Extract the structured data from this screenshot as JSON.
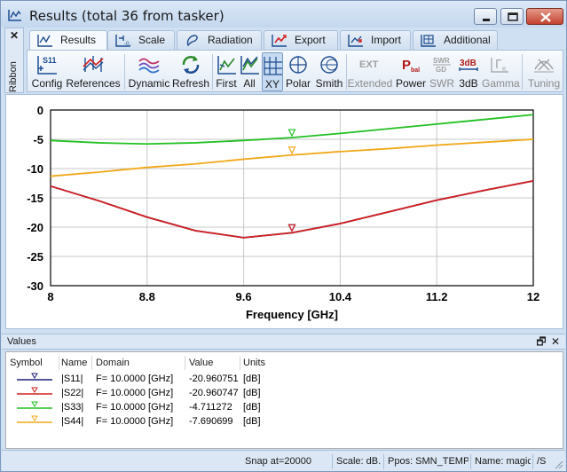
{
  "window": {
    "title": "Results (total 36 from tasker)"
  },
  "ribbon": {
    "close_glyph": "✕",
    "side_label": "Ribbon",
    "tabs": [
      {
        "label": "Results",
        "icon": "results-tab-icon"
      },
      {
        "label": "Scale",
        "icon": "scale-tab-icon"
      },
      {
        "label": "Radiation",
        "icon": "radiation-tab-icon"
      },
      {
        "label": "Export",
        "icon": "export-tab-icon"
      },
      {
        "label": "Import",
        "icon": "import-tab-icon"
      },
      {
        "label": "Additional",
        "icon": "additional-tab-icon"
      }
    ],
    "active_tab": "Results",
    "buttons": [
      {
        "label": "Config",
        "icon": "s11-config-icon",
        "enabled": true
      },
      {
        "label": "References",
        "icon": "references-icon",
        "enabled": true
      },
      {
        "label": "Dynamic",
        "icon": "dynamic-waves-icon",
        "enabled": true
      },
      {
        "label": "Refresh",
        "icon": "refresh-icon",
        "enabled": true
      },
      {
        "label": "First",
        "icon": "first-chart-icon",
        "enabled": true
      },
      {
        "label": "All",
        "icon": "all-chart-icon",
        "enabled": true
      },
      {
        "label": "XY",
        "icon": "xy-grid-icon",
        "enabled": true,
        "pressed": true
      },
      {
        "label": "Polar",
        "icon": "polar-icon",
        "enabled": true
      },
      {
        "label": "Smith",
        "icon": "smith-chart-icon",
        "enabled": true
      },
      {
        "label": "Extended",
        "icon_text": "EXT",
        "icon": "extended-icon",
        "enabled": false
      },
      {
        "label": "Power",
        "icon_text": "P",
        "icon_sub": "bal",
        "icon": "power-balance-icon",
        "enabled": true
      },
      {
        "label": "SWR",
        "icon_text": "SWR",
        "icon_sub": "GD",
        "icon": "swr-icon",
        "enabled": false
      },
      {
        "label": "3dB",
        "icon_text": "3dB",
        "icon": "3db-icon",
        "enabled": true
      },
      {
        "label": "Gamma",
        "icon_text": "Γ",
        "icon_sub": "K",
        "icon": "gamma-icon",
        "enabled": false
      },
      {
        "label": "Tuning",
        "icon": "tuning-icon",
        "enabled": false
      }
    ]
  },
  "chart_data": {
    "type": "line",
    "xlabel": "Frequency [GHz]",
    "ylabel": "",
    "xlim": [
      8,
      12
    ],
    "ylim": [
      -30,
      0
    ],
    "x_ticks": [
      "8",
      "8.8",
      "9.6",
      "10.4",
      "11.2",
      "12"
    ],
    "y_ticks": [
      "0",
      "-5",
      "-10",
      "-15",
      "-20",
      "-25",
      "-30"
    ],
    "grid": true,
    "series": [
      {
        "name": "|S11|",
        "color": "#1f1f7a",
        "x": [
          8,
          8.4,
          8.8,
          9.2,
          9.6,
          10.0,
          10.4,
          10.8,
          11.2,
          11.6,
          12
        ],
        "y": [
          -13.0,
          -15.5,
          -18.3,
          -20.6,
          -21.8,
          -20.96,
          -19.4,
          -17.4,
          -15.4,
          -13.7,
          -12.1
        ]
      },
      {
        "name": "|S22|",
        "color": "#d42020",
        "x": [
          8,
          8.4,
          8.8,
          9.2,
          9.6,
          10.0,
          10.4,
          10.8,
          11.2,
          11.6,
          12
        ],
        "y": [
          -13.0,
          -15.5,
          -18.3,
          -20.6,
          -21.8,
          -20.96,
          -19.4,
          -17.4,
          -15.4,
          -13.7,
          -12.1
        ]
      },
      {
        "name": "|S33|",
        "color": "#22c022",
        "x": [
          8,
          8.4,
          8.8,
          9.2,
          9.6,
          10.0,
          10.4,
          10.8,
          11.2,
          11.6,
          12
        ],
        "y": [
          -5.2,
          -5.6,
          -5.8,
          -5.6,
          -5.2,
          -4.71,
          -4.0,
          -3.2,
          -2.4,
          -1.6,
          -0.8
        ]
      },
      {
        "name": "|S44|",
        "color": "#f0a818",
        "x": [
          8,
          8.4,
          8.8,
          9.2,
          9.6,
          10.0,
          10.4,
          10.8,
          11.2,
          11.6,
          12
        ],
        "y": [
          -11.3,
          -10.6,
          -9.8,
          -9.2,
          -8.4,
          -7.69,
          -7.1,
          -6.6,
          -6.0,
          -5.5,
          -5.0
        ]
      }
    ],
    "marker_x": 10.0
  },
  "values_panel": {
    "title": "Values",
    "float_glyph": "🗗",
    "close_glyph": "✕",
    "columns": [
      "Symbol",
      "Name",
      "Domain",
      "Value",
      "Units"
    ],
    "rows": [
      {
        "name": "|S11|",
        "domain": "F= 10.0000 [GHz]",
        "value": "-20.960751",
        "units": "[dB]",
        "color": "#1f1f7a"
      },
      {
        "name": "|S22|",
        "domain": "F= 10.0000 [GHz]",
        "value": "-20.960747",
        "units": "[dB]",
        "color": "#d42020"
      },
      {
        "name": "|S33|",
        "domain": "F= 10.0000 [GHz]",
        "value": "-4.711272",
        "units": "[dB]",
        "color": "#22c022"
      },
      {
        "name": "|S44|",
        "domain": "F= 10.0000 [GHz]",
        "value": "-7.690699",
        "units": "[dB]",
        "color": "#f0a818"
      }
    ]
  },
  "statusbar": {
    "snap": "Snap at=20000",
    "scale": "Scale: dB.",
    "ppos": "Ppos: SMN_TEMPL",
    "name": "Name: magict",
    "extra": "/S"
  }
}
